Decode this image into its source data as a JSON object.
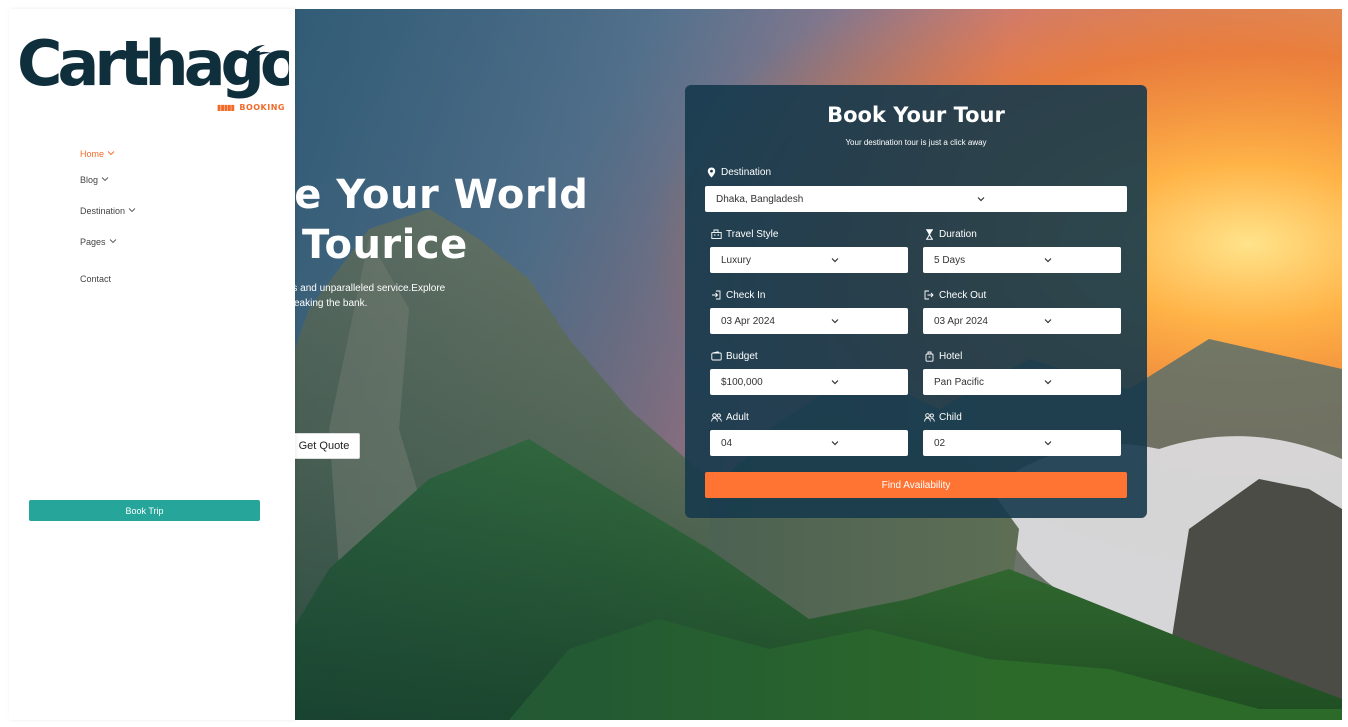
{
  "brand": {
    "logo_text": "Carthago",
    "logo_sub": "BOOKING",
    "colors": {
      "orange": "#f26a2a",
      "teal": "#26a69a",
      "navy": "#0f2f3d"
    }
  },
  "nav": {
    "items": [
      {
        "label": "Home",
        "has_dropdown": true,
        "active": true
      },
      {
        "label": "Blog",
        "has_dropdown": true,
        "active": false
      },
      {
        "label": "Destination",
        "has_dropdown": true,
        "active": false
      },
      {
        "label": "Pages",
        "has_dropdown": true,
        "active": false
      },
      {
        "label": "Contact",
        "has_dropdown": false,
        "active": false
      }
    ],
    "book_trip_label": "Book Trip"
  },
  "hero": {
    "title_line1": "ore Your World",
    "title_line2": "Tourice",
    "subtitle_line1": "itineraries and unparalleled service.Explore",
    "subtitle_line2": "eaking the bank.",
    "quote_button": "Get Quote"
  },
  "booking": {
    "title": "Book Your Tour",
    "subtitle": "Your destination tour is just a click away",
    "destination": {
      "label": "Destination",
      "value": "Dhaka, Bangladesh",
      "icon": "map-pin-icon"
    },
    "travel_style": {
      "label": "Travel Style",
      "value": "Luxury",
      "icon": "building-icon"
    },
    "duration": {
      "label": "Duration",
      "value": "5 Days",
      "icon": "hourglass-icon"
    },
    "check_in": {
      "label": "Check In",
      "value": "03 Apr 2024",
      "icon": "login-icon"
    },
    "check_out": {
      "label": "Check Out",
      "value": "03 Apr 2024",
      "icon": "logout-icon"
    },
    "budget": {
      "label": "Budget",
      "value": "$100,000",
      "icon": "wallet-icon"
    },
    "hotel": {
      "label": "Hotel",
      "value": "Pan Pacific",
      "icon": "hotel-icon"
    },
    "adult": {
      "label": "Adult",
      "value": "04",
      "icon": "users-icon"
    },
    "child": {
      "label": "Child",
      "value": "02",
      "icon": "users-icon"
    },
    "submit_label": "Find Availability"
  }
}
